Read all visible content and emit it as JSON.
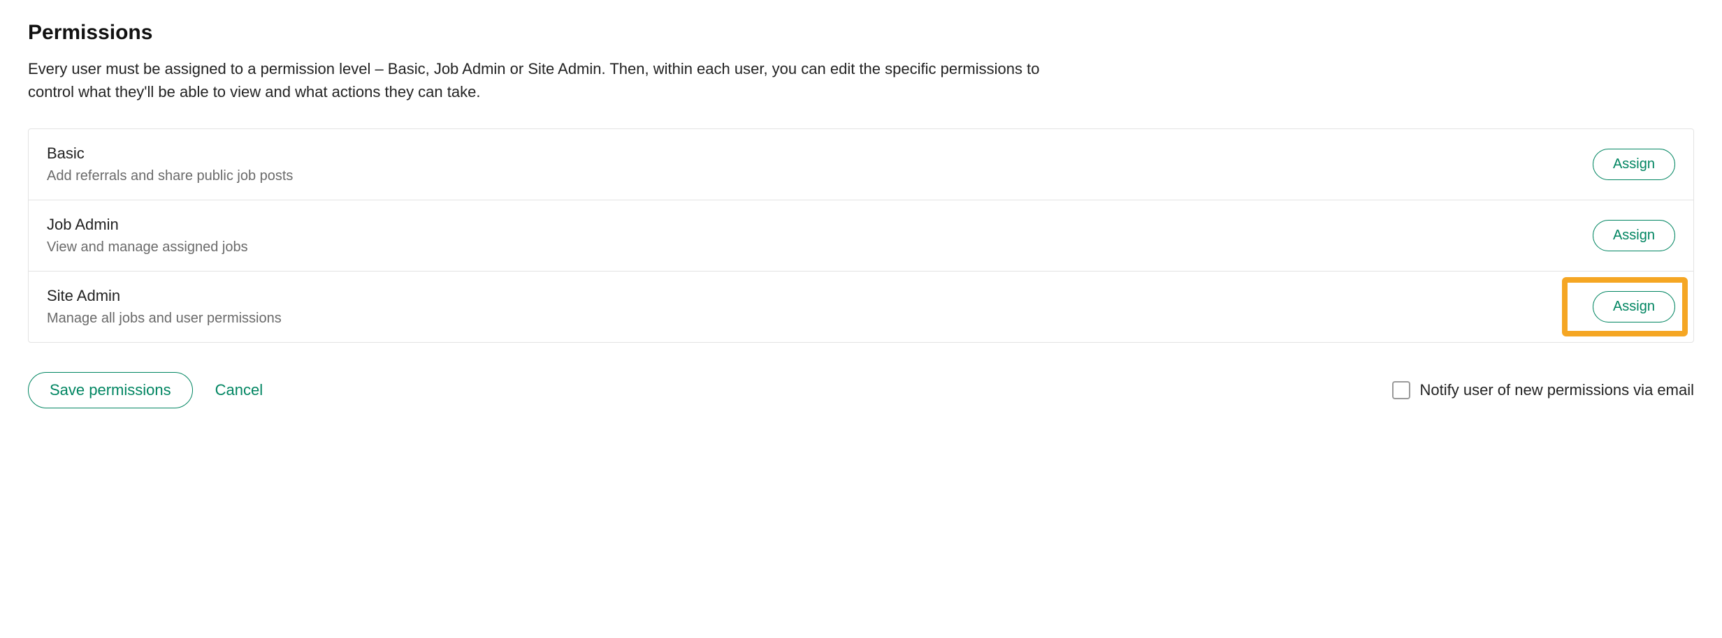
{
  "heading": "Permissions",
  "description": "Every user must be assigned to a permission level – Basic, Job Admin or Site Admin. Then, within each user, you can edit the specific permissions to control what they'll be able to view and what actions they can take.",
  "levels": [
    {
      "title": "Basic",
      "desc": "Add referrals and share public job posts",
      "button": "Assign",
      "highlighted": false
    },
    {
      "title": "Job Admin",
      "desc": "View and manage assigned jobs",
      "button": "Assign",
      "highlighted": false
    },
    {
      "title": "Site Admin",
      "desc": "Manage all jobs and user permissions",
      "button": "Assign",
      "highlighted": true
    }
  ],
  "footer": {
    "save": "Save permissions",
    "cancel": "Cancel",
    "notify_label": "Notify user of new permissions via email"
  }
}
